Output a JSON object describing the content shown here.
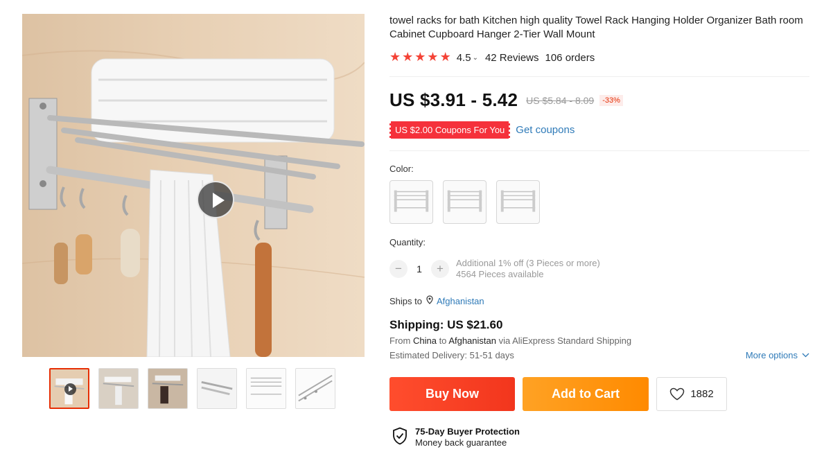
{
  "product": {
    "title": "towel racks for bath Kitchen high quality Towel Rack Hanging Holder Organizer Bath room Cabinet Cupboard Hanger 2-Tier Wall Mount"
  },
  "rating": {
    "value": "4.5",
    "stars": 5,
    "reviews": "42 Reviews",
    "orders": "106 orders"
  },
  "price": {
    "current": "US $3.91 - 5.42",
    "original": "US $5.84 - 8.09",
    "discount": "-33%"
  },
  "coupon": {
    "label": "US $2.00 Coupons For You",
    "link": "Get coupons"
  },
  "color": {
    "label": "Color:"
  },
  "quantity": {
    "label": "Quantity:",
    "value": "1",
    "minus": "−",
    "plus": "+",
    "offer": "Additional 1% off (3 Pieces or more)",
    "available": "4564 Pieces available"
  },
  "ships": {
    "label": "Ships to",
    "country": "Afghanistan"
  },
  "shipping": {
    "title": "Shipping: US $21.60",
    "from_prefix": "From",
    "from": "China",
    "to_prefix": "to",
    "to": "Afghanistan",
    "via": "via AliExpress Standard Shipping",
    "delivery": "Estimated Delivery: 51-51 days",
    "more_options": "More options"
  },
  "actions": {
    "buy_now": "Buy Now",
    "add_to_cart": "Add to Cart",
    "wishlist_count": "1882"
  },
  "protection": {
    "title": "75-Day Buyer Protection",
    "subtitle": "Money back guarantee"
  },
  "colors": {
    "accent_red": "#e62e04",
    "buy_now": "#f2361d",
    "add_to_cart": "#ff8a00",
    "link": "#2e7ab8",
    "star": "#f44336"
  }
}
